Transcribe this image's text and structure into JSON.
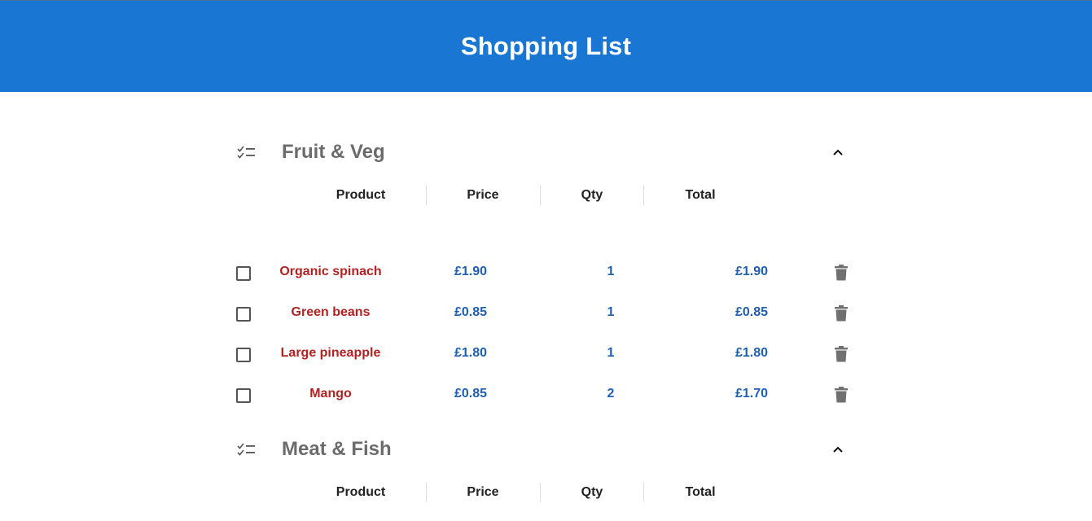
{
  "app": {
    "title": "Shopping List"
  },
  "columns": {
    "product": "Product",
    "price": "Price",
    "qty": "Qty",
    "total": "Total"
  },
  "categories": [
    {
      "name": "Fruit & Veg",
      "icon": "checklist-icon",
      "expanded": true,
      "items": [
        {
          "product": "Organic spinach",
          "price": "£1.90",
          "qty": "1",
          "total": "£1.90",
          "checked": false
        },
        {
          "product": "Green beans",
          "price": "£0.85",
          "qty": "1",
          "total": "£0.85",
          "checked": false
        },
        {
          "product": "Large pineapple",
          "price": "£1.80",
          "qty": "1",
          "total": "£1.80",
          "checked": false
        },
        {
          "product": "Mango",
          "price": "£0.85",
          "qty": "2",
          "total": "£1.70",
          "checked": false
        }
      ]
    },
    {
      "name": "Meat & Fish",
      "icon": "checklist-icon",
      "expanded": true,
      "items": []
    }
  ],
  "colors": {
    "header_bg": "#1976d2",
    "product_text": "#b22222",
    "value_text": "#1f5fb0",
    "category_text": "#6b6b6b",
    "icon_gray": "#707070"
  }
}
